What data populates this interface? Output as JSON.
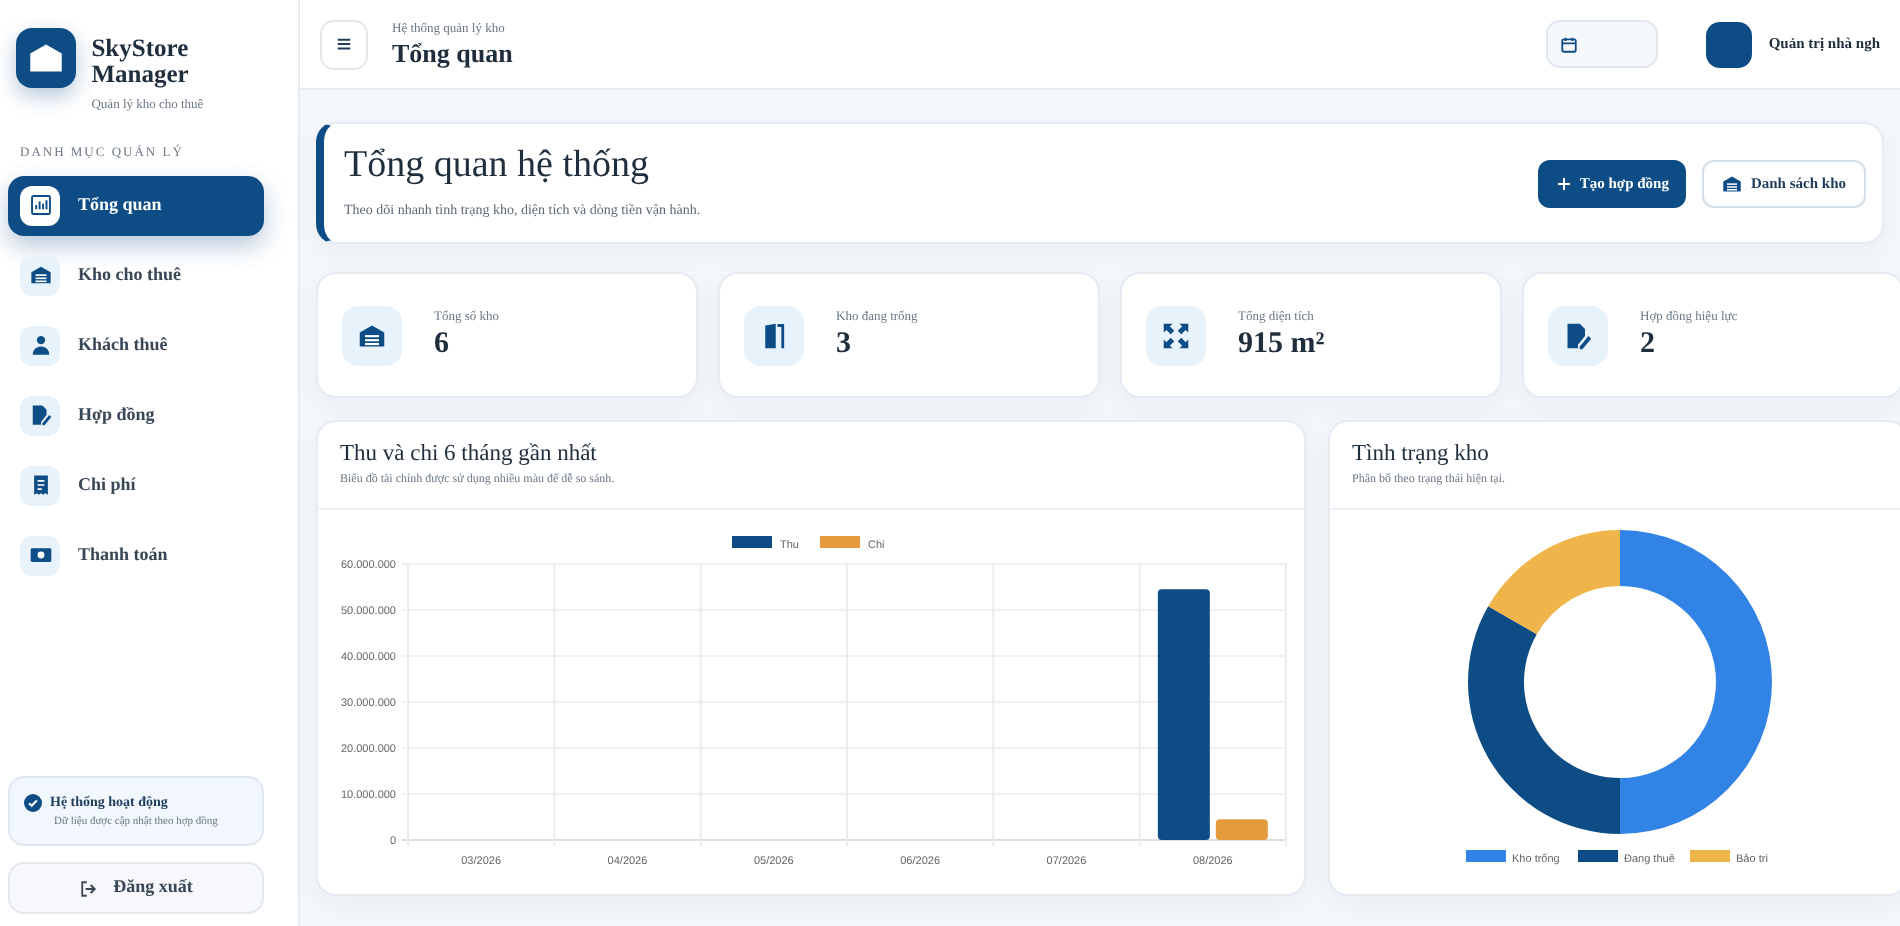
{
  "brand": {
    "name": "SkyStore Manager",
    "tagline": "Quản lý kho cho thuê"
  },
  "sidebar": {
    "section_label": "DANH MỤC QUẢN LÝ",
    "items": [
      {
        "label": "Tổng quan",
        "selected": true
      },
      {
        "label": "Kho cho thuê",
        "selected": false
      },
      {
        "label": "Khách thuê",
        "selected": false
      },
      {
        "label": "Hợp đồng",
        "selected": false
      },
      {
        "label": "Chi phí",
        "selected": false
      },
      {
        "label": "Thanh toán",
        "selected": false
      }
    ],
    "status": {
      "title": "Hệ thống hoạt động",
      "text": "Dữ liệu được cập nhật theo hợp đồng"
    },
    "logout": "Đăng xuất"
  },
  "header": {
    "breadcrumb": "Hệ thống quản lý kho",
    "title": "Tổng quan",
    "user_name": "Quản trị nhà ngh"
  },
  "hero": {
    "title": "Tổng quan hệ thống",
    "subtitle": "Theo dõi nhanh tình trạng kho, diện tích và dòng tiền vận hành.",
    "buttons": [
      {
        "label": "Tạo hợp đồng",
        "kind": "primary"
      },
      {
        "label": "Danh sách kho",
        "kind": "outline"
      }
    ]
  },
  "stats": [
    {
      "label": "Tổng số kho",
      "value": "6"
    },
    {
      "label": "Kho đang trống",
      "value": "3"
    },
    {
      "label": "Tổng diện tích",
      "value": "915 m²"
    },
    {
      "label": "Hợp đồng hiệu lực",
      "value": "2"
    }
  ],
  "finance_card": {
    "title": "Thu và chi 6 tháng gần nhất",
    "subtitle": "Biểu đồ tài chính được sử dụng nhiều màu để dễ so sánh.",
    "chart_data": {
      "type": "bar",
      "grid": true,
      "legend": "top",
      "categories": [
        "03/2026",
        "04/2026",
        "05/2026",
        "06/2026",
        "07/2026",
        "08/2026"
      ],
      "series": [
        {
          "name": "Thu",
          "color": "#0d4c85",
          "values": [
            0,
            0,
            0,
            0,
            0,
            54500000
          ]
        },
        {
          "name": "Chi",
          "color": "#e39b3e",
          "values": [
            0,
            0,
            0,
            0,
            0,
            4500000
          ]
        }
      ],
      "ylim": [
        0,
        60000000
      ],
      "yticks": [
        {
          "value": 0,
          "label": "0"
        },
        {
          "value": 10000000,
          "label": "10.000.000"
        },
        {
          "value": 20000000,
          "label": "20.000.000"
        },
        {
          "value": 30000000,
          "label": "30.000.000"
        },
        {
          "value": 40000000,
          "label": "40.000.000"
        },
        {
          "value": 50000000,
          "label": "50.000.000"
        },
        {
          "value": 60000000,
          "label": "60.000.000"
        }
      ]
    }
  },
  "status_card": {
    "title": "Tình trạng kho",
    "subtitle": "Phân bổ theo trạng thái hiện tại.",
    "chart_data": {
      "type": "donut",
      "legend": "bottom",
      "categories": [
        "Kho trống",
        "Đang thuê",
        "Bảo trì"
      ],
      "colors": [
        "#3283e6",
        "#0d4c85",
        "#f0b54a"
      ],
      "values": [
        50,
        33.3,
        16.7
      ]
    }
  }
}
